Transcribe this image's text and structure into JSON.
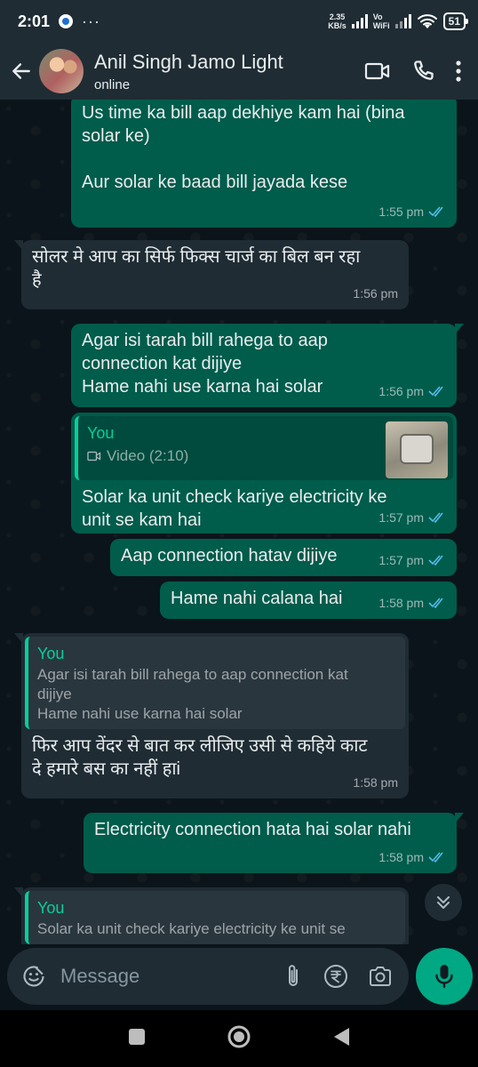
{
  "status_bar": {
    "time": "2:01",
    "more": "···",
    "speed_value": "2.35",
    "speed_unit": "KB/s",
    "vowifi_top": "Vo",
    "vowifi_bottom": "WiFi",
    "battery": "51"
  },
  "header": {
    "contact_name": "Anil Singh Jamo Light",
    "status": "online",
    "icons": [
      "back-arrow-icon",
      "video-call-icon",
      "phone-icon",
      "more-vert-icon"
    ]
  },
  "messages": [
    {
      "direction": "out",
      "lines": [
        "Us time ka bill aap dekhiye kam hai (bina",
        "solar ke)",
        "",
        "Aur solar ke baad bill jayada kese"
      ],
      "time": "1:55 pm",
      "read": true
    },
    {
      "direction": "in",
      "lines": [
        "सोलर मे आप का सिर्फ फिक्स चार्ज का बिल बन रहा",
        "है"
      ],
      "time": "1:56 pm"
    },
    {
      "direction": "out",
      "lines": [
        "Agar isi tarah bill rahega to aap",
        "connection kat dijiye",
        "Hame nahi use karna hai solar"
      ],
      "time": "1:56 pm",
      "read": true
    },
    {
      "direction": "out",
      "quote": {
        "author": "You",
        "text": "Video (2:10)",
        "icon": "video-camera-icon",
        "has_thumbnail": true
      },
      "lines": [
        "Solar ka unit check kariye electricity ke",
        "unit se kam hai"
      ],
      "time": "1:57 pm",
      "read": true
    },
    {
      "direction": "out",
      "lines": [
        "Aap connection hatav dijiye"
      ],
      "time": "1:57 pm",
      "read": true
    },
    {
      "direction": "out",
      "lines": [
        "Hame nahi calana hai"
      ],
      "time": "1:58 pm",
      "read": true
    },
    {
      "direction": "in",
      "quote": {
        "author": "You",
        "lines": [
          "Agar isi tarah bill rahega to aap connection kat",
          "dijiye",
          "Hame nahi use karna hai solar"
        ]
      },
      "lines": [
        "फिर आप वेंदर से बात कर लीजिए उसी से कहिये काट",
        "दे हमारे बस का नहीं हाi"
      ],
      "time": "1:58 pm"
    },
    {
      "direction": "out",
      "lines": [
        "Electricity connection hata hai solar nahi"
      ],
      "time": "1:58 pm",
      "read": true
    },
    {
      "direction": "in",
      "quote": {
        "author": "You",
        "lines": [
          "Solar ka unit check kariye electricity ke unit se"
        ]
      },
      "lines": [],
      "time": ""
    }
  ],
  "composer": {
    "placeholder": "Message",
    "icons": [
      "emoji-icon",
      "attach-icon",
      "rupee-payment-icon",
      "camera-icon",
      "mic-icon"
    ]
  },
  "colors": {
    "outgoing_bubble": "#005c4b",
    "incoming_bubble": "#1f2c34",
    "accent": "#00a884",
    "read_tick": "#53bdeb"
  }
}
